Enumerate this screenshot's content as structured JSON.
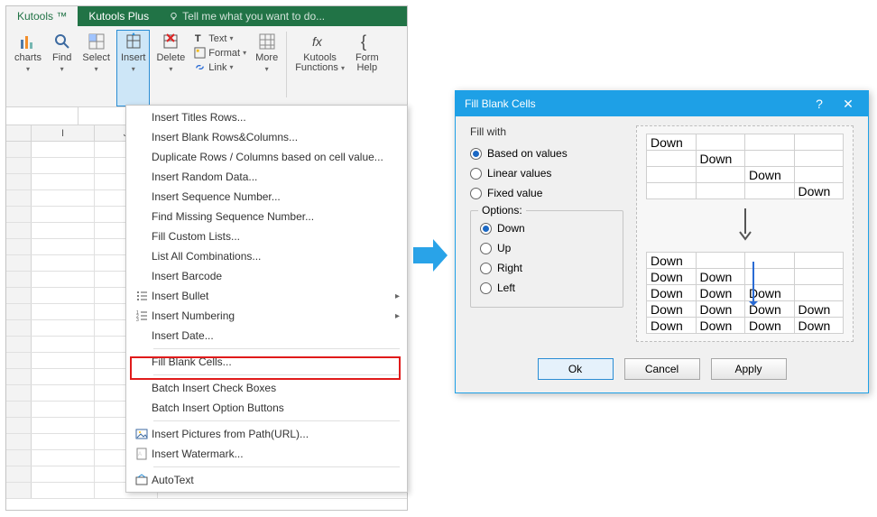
{
  "tabs": {
    "active": "Kutools ™",
    "plus": "Kutools Plus",
    "tellme": "Tell me what you want to do..."
  },
  "ribbon": {
    "charts": "charts",
    "find": "Find",
    "select": "Select",
    "insert": "Insert",
    "delete": "Delete",
    "text": "Text",
    "format": "Format",
    "link": "Link",
    "more": "More",
    "kfunc": "Kutools",
    "kfunc2": "Functions",
    "formhelp": "Form",
    "formhelp2": "Help"
  },
  "cols": [
    "I",
    "J"
  ],
  "menu": {
    "titlesRows": "Insert Titles Rows...",
    "blankRowsCols": "Insert Blank Rows&Columns...",
    "dupRowsCols": "Duplicate Rows / Columns based on cell value...",
    "randomData": "Insert Random Data...",
    "seqNumber": "Insert Sequence Number...",
    "findMissing": "Find Missing Sequence Number...",
    "customLists": "Fill Custom Lists...",
    "listCombos": "List All Combinations...",
    "barcode": "Insert Barcode",
    "bullet": "Insert Bullet",
    "numbering": "Insert Numbering",
    "date": "Insert Date...",
    "fillBlank": "Fill Blank Cells...",
    "checkBoxes": "Batch Insert Check Boxes",
    "optionBtns": "Batch Insert Option Buttons",
    "picsUrl": "Insert Pictures from Path(URL)...",
    "watermark": "Insert Watermark...",
    "autotext": "AutoText"
  },
  "dialog": {
    "title": "Fill Blank Cells",
    "help": "?",
    "close": "✕",
    "fillWith": "Fill with",
    "basedOnValues": "Based on values",
    "linearValues": "Linear values",
    "fixedValue": "Fixed value",
    "options": "Options:",
    "down": "Down",
    "up": "Up",
    "right": "Right",
    "left": "Left",
    "previewWord": "Down",
    "ok": "Ok",
    "cancel": "Cancel",
    "apply": "Apply"
  }
}
